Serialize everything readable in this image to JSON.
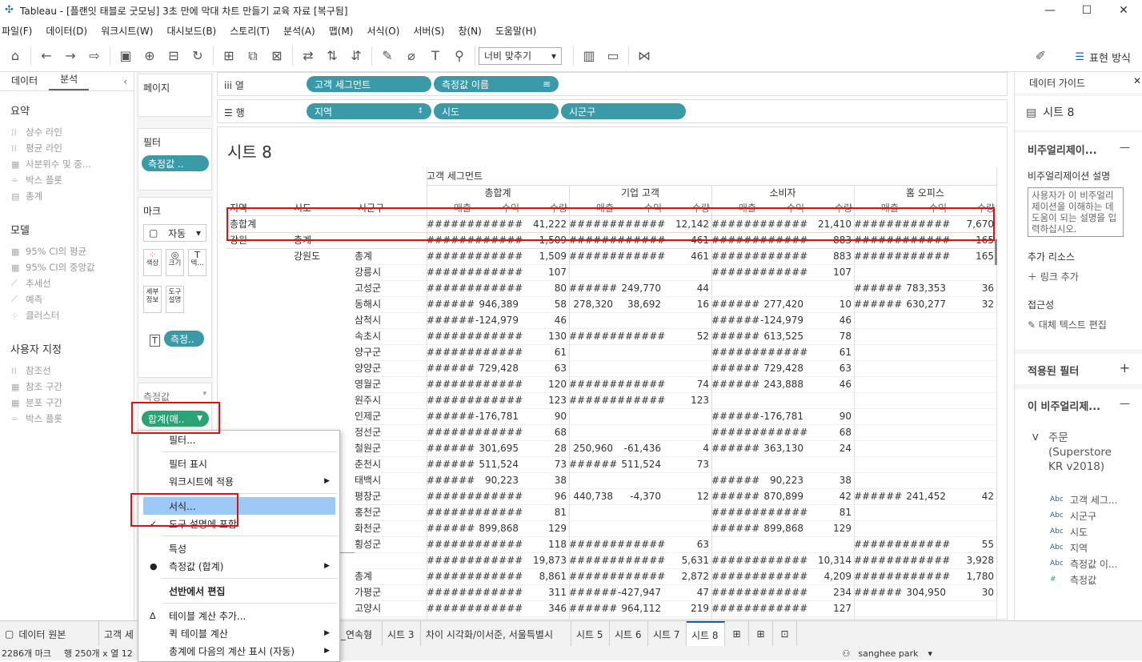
{
  "window": {
    "title": "Tableau - [플랜잇 태블로 굿모닝] 3초 만에 막대 차트 만들기 교육 자료 [복구됨]",
    "min": "—",
    "max": "☐",
    "close": "✕"
  },
  "menu": [
    "파일(F)",
    "데이터(D)",
    "워크시트(W)",
    "대시보드(B)",
    "스토리(T)",
    "분석(A)",
    "맵(M)",
    "서식(O)",
    "서버(S)",
    "창(N)",
    "도움말(H)"
  ],
  "toolbar": {
    "fit_label": "너비 맞추기",
    "show_me": "표현 방식"
  },
  "leftpane": {
    "tab_data": "데이터",
    "tab_analysis": "분석",
    "summary_header": "요약",
    "summary": [
      "상수 라인",
      "평균 라인",
      "사분위수 및 중...",
      "박스 플롯",
      "총계"
    ],
    "model_header": "모델",
    "model": [
      "95% CI의 평균",
      "95% CI의 중앙값",
      "추세선",
      "예측",
      "클러스터"
    ],
    "custom_header": "사용자 지정",
    "custom": [
      "참조선",
      "참조 구간",
      "분포 구간",
      "박스 플롯"
    ]
  },
  "shelves": {
    "pages": "페이지",
    "filters": "필터",
    "filter_pill": "측정값 ..",
    "marks": "마크",
    "marks_type": "자동",
    "mark_buttons": [
      "색상",
      "크기",
      "텍...",
      "세부 정보",
      "도구 설명"
    ],
    "marks_pill": "측정..",
    "measures_label": "측정값",
    "measure_pill": "합계(매.."
  },
  "columns": {
    "label": "열",
    "pills": [
      "고객 세그먼트",
      "측정값 이름"
    ]
  },
  "rows": {
    "label": "행",
    "pills": [
      "지역",
      "시도",
      "시군구"
    ]
  },
  "view": {
    "title": "시트 8",
    "col_group": "고객 세그먼트",
    "segments": [
      "총합계",
      "기업 고객",
      "소비자",
      "홈 오피스"
    ],
    "measures": [
      "매출",
      "수익",
      "수량"
    ],
    "row_headers": [
      "지역",
      "시도",
      "시군구"
    ],
    "rows": [
      {
        "a": "총합계",
        "b": "",
        "c": "",
        "v": [
          "######",
          "######",
          "41,222",
          "######",
          "######",
          "12,142",
          "######",
          "######",
          "21,410",
          "######",
          "######",
          "7,670"
        ]
      },
      {
        "a": "강원",
        "b": "총계",
        "c": "",
        "v": [
          "######",
          "######",
          "1,509",
          "######",
          "######",
          "461",
          "######",
          "######",
          "883",
          "######",
          "######",
          "165"
        ]
      },
      {
        "a": "",
        "b": "강원도",
        "c": "총계",
        "v": [
          "######",
          "######",
          "1,509",
          "######",
          "######",
          "461",
          "######",
          "######",
          "883",
          "######",
          "######",
          "165"
        ]
      },
      {
        "a": "",
        "b": "",
        "c": "강릉시",
        "v": [
          "######",
          "######",
          "107",
          "",
          "",
          "",
          "######",
          "######",
          "107",
          "",
          "",
          ""
        ]
      },
      {
        "a": "",
        "b": "",
        "c": "고성군",
        "v": [
          "######",
          "######",
          "80",
          "######",
          "249,770",
          "44",
          "",
          "",
          "",
          "######",
          "783,353",
          "36"
        ]
      },
      {
        "a": "",
        "b": "",
        "c": "동해시",
        "v": [
          "######",
          "946,389",
          "58",
          "278,320",
          "38,692",
          "16",
          "######",
          "277,420",
          "10",
          "######",
          "630,277",
          "32"
        ]
      },
      {
        "a": "",
        "b": "",
        "c": "삼척시",
        "v": [
          "######",
          "-124,979",
          "46",
          "",
          "",
          "",
          "######",
          "-124,979",
          "46",
          "",
          "",
          ""
        ]
      },
      {
        "a": "",
        "b": "",
        "c": "속초시",
        "v": [
          "######",
          "######",
          "130",
          "######",
          "######",
          "52",
          "######",
          "613,525",
          "78",
          "",
          "",
          ""
        ]
      },
      {
        "a": "",
        "b": "",
        "c": "양구군",
        "v": [
          "######",
          "######",
          "61",
          "",
          "",
          "",
          "######",
          "######",
          "61",
          "",
          "",
          ""
        ]
      },
      {
        "a": "",
        "b": "",
        "c": "양양군",
        "v": [
          "######",
          "729,428",
          "63",
          "",
          "",
          "",
          "######",
          "729,428",
          "63",
          "",
          "",
          ""
        ]
      },
      {
        "a": "",
        "b": "",
        "c": "영월군",
        "v": [
          "######",
          "######",
          "120",
          "######",
          "######",
          "74",
          "######",
          "243,888",
          "46",
          "",
          "",
          ""
        ]
      },
      {
        "a": "",
        "b": "",
        "c": "원주시",
        "v": [
          "######",
          "######",
          "123",
          "######",
          "######",
          "123",
          "",
          "",
          "",
          "",
          "",
          ""
        ]
      },
      {
        "a": "",
        "b": "",
        "c": "인제군",
        "v": [
          "######",
          "-176,781",
          "90",
          "",
          "",
          "",
          "######",
          "-176,781",
          "90",
          "",
          "",
          ""
        ]
      },
      {
        "a": "",
        "b": "",
        "c": "정선군",
        "v": [
          "######",
          "######",
          "68",
          "",
          "",
          "",
          "######",
          "######",
          "68",
          "",
          "",
          ""
        ]
      },
      {
        "a": "",
        "b": "",
        "c": "철원군",
        "v": [
          "######",
          "301,695",
          "28",
          "250,960",
          "-61,436",
          "4",
          "######",
          "363,130",
          "24",
          "",
          "",
          ""
        ]
      },
      {
        "a": "",
        "b": "",
        "c": "춘천시",
        "v": [
          "######",
          "511,524",
          "73",
          "######",
          "511,524",
          "73",
          "",
          "",
          "",
          "",
          "",
          ""
        ]
      },
      {
        "a": "",
        "b": "",
        "c": "태백시",
        "v": [
          "######",
          "90,223",
          "38",
          "",
          "",
          "",
          "######",
          "90,223",
          "38",
          "",
          "",
          ""
        ]
      },
      {
        "a": "",
        "b": "",
        "c": "평창군",
        "v": [
          "######",
          "######",
          "96",
          "440,738",
          "-4,370",
          "12",
          "######",
          "870,899",
          "42",
          "######",
          "241,452",
          "42"
        ]
      },
      {
        "a": "",
        "b": "",
        "c": "홍천군",
        "v": [
          "######",
          "######",
          "81",
          "",
          "",
          "",
          "######",
          "######",
          "81",
          "",
          "",
          ""
        ]
      },
      {
        "a": "",
        "b": "",
        "c": "화천군",
        "v": [
          "######",
          "899,868",
          "129",
          "",
          "",
          "",
          "######",
          "899,868",
          "129",
          "",
          "",
          ""
        ]
      },
      {
        "a": "",
        "b": "",
        "c": "횡성군",
        "v": [
          "######",
          "######",
          "118",
          "######",
          "######",
          "63",
          "",
          "",
          "",
          "######",
          "######",
          "55"
        ]
      },
      {
        "a": "",
        "b": "",
        "c": "",
        "v": [
          "######",
          "######",
          "19,873",
          "######",
          "######",
          "5,631",
          "######",
          "######",
          "10,314",
          "######",
          "######",
          "3,928"
        ]
      },
      {
        "a": "",
        "b": "",
        "c": "총계",
        "v": [
          "######",
          "######",
          "8,861",
          "######",
          "######",
          "2,872",
          "######",
          "######",
          "4,209",
          "######",
          "######",
          "1,780"
        ]
      },
      {
        "a": "",
        "b": "",
        "c": "가평군",
        "v": [
          "######",
          "######",
          "311",
          "######",
          "-427,947",
          "47",
          "######",
          "######",
          "234",
          "######",
          "304,950",
          "30"
        ]
      },
      {
        "a": "",
        "b": "",
        "c": "고양시",
        "v": [
          "######",
          "######",
          "346",
          "######",
          "964,112",
          "219",
          "######",
          "######",
          "127",
          "",
          "",
          ""
        ]
      }
    ]
  },
  "rightpane": {
    "header": "데이터 가이드",
    "sheet": "시트 8",
    "viz_header": "비주얼리제이...",
    "desc_label": "비주얼리제이션 설명",
    "desc_placeholder": "사용자가 이 비주얼리제이션을 이해하는 데 도움이 되는 설명을 입력하십시오.",
    "resources": "추가 리소스",
    "add_link": "링크 추가",
    "access": "접근성",
    "alt_text": "대체 텍스트 편집",
    "filters": "적용된 필터",
    "this_viz": "이 비주얼리제...",
    "source": "주문 (Superstore KR v2018)",
    "fields": [
      {
        "type": "Abc",
        "name": "고객 세그..."
      },
      {
        "type": "Abc",
        "name": "시군구"
      },
      {
        "type": "Abc",
        "name": "시도"
      },
      {
        "type": "Abc",
        "name": "지역"
      },
      {
        "type": "Abc",
        "name": "측정값 이..."
      },
      {
        "type": "#",
        "name": "측정값"
      }
    ]
  },
  "tabs": [
    "데이터 원본",
    "고객 세",
    "_연속형",
    "시트 3",
    "차이 시각화/이서준, 서울특별시",
    "시트 5",
    "시트 6",
    "시트 7",
    "시트 8"
  ],
  "status": {
    "marks": "2286개 마크",
    "rows": "행 250개 x 열 12",
    "user": "sanghee park"
  },
  "context_menu": {
    "items": [
      "필터...",
      "필터 표시",
      "워크시트에 적용",
      "서식...",
      "도구 설명에 포함",
      "특성",
      "측정값 (합계)",
      "선반에서 편집",
      "테이블 계산 추가...",
      "퀵 테이블 계산",
      "총계에 다음의 계산 표시 (자동)"
    ]
  }
}
